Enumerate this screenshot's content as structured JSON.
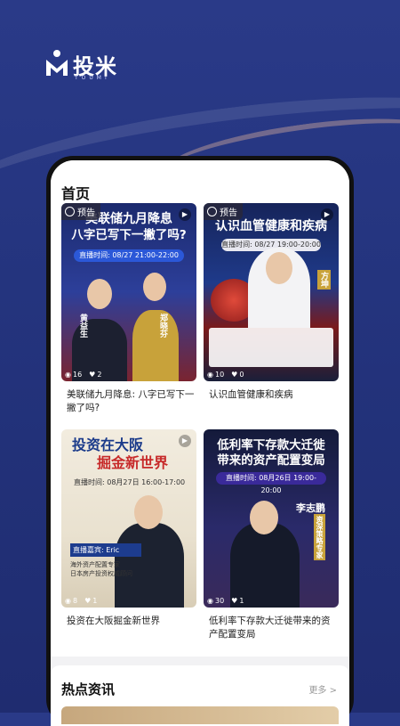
{
  "brand": {
    "name": "投米",
    "sub": "TOUMI"
  },
  "home": {
    "title": "首页"
  },
  "cards": [
    {
      "tag": "预告",
      "headline_line1": "美联储九月降息",
      "headline_line2": "八字已写下一撇了吗?",
      "time": "直播时间: 08/27 21:00-22:00",
      "guest_left": "黄益生",
      "guest_right": "郑晓芬",
      "views": "16",
      "likes": "2",
      "title": "美联储九月降息: 八字已写下一撇了吗?"
    },
    {
      "tag": "预告",
      "headline_line1": "认识血管健康和疾病",
      "time": "直播时间: 08/27 19:00-20:00",
      "guest": "方坤",
      "views": "10",
      "likes": "0",
      "title": "认识血管健康和疾病"
    },
    {
      "headline_line1": "投资在大阪",
      "headline_line2": "掘金新世界",
      "time": "直播时间: 08月27日 16:00-17:00",
      "guest_label": "直播嘉宾: Eric",
      "guest_desc1": "海外资产配置专家",
      "guest_desc2": "日本房产投资权威顾问",
      "views": "8",
      "likes": "1",
      "title": "投资在大阪掘金新世界"
    },
    {
      "headline_line1": "低利率下存款大迁徙",
      "headline_line2": "带来的资产配置变局",
      "time": "直播时间: 08月26日 19:00-20:00",
      "guest": "李志鹏",
      "guest_desc": "资深策略专家",
      "views": "30",
      "likes": "1",
      "title": "低利率下存款大迁徙带来的资产配置变局"
    }
  ],
  "news": {
    "title": "热点资讯",
    "more": "更多 >"
  },
  "colors": {
    "bg": "#24347e",
    "accent": "#d8362e"
  }
}
